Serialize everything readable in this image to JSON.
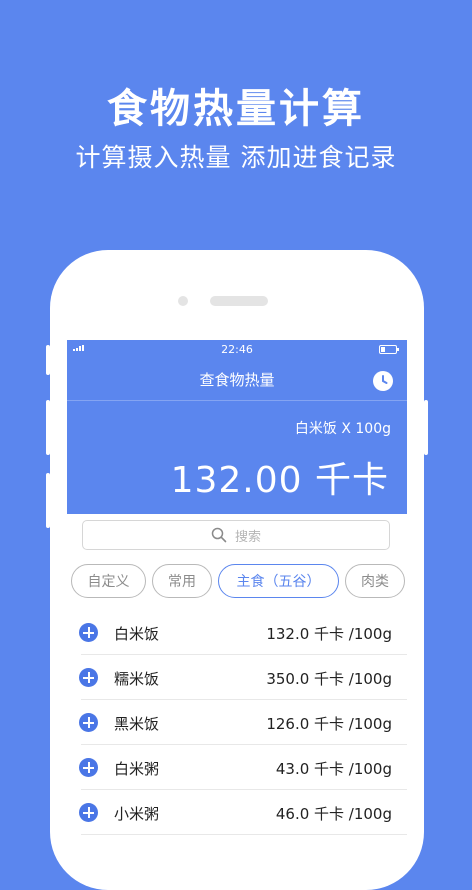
{
  "promo": {
    "title": "食物热量计算",
    "subtitle": "计算摄入热量 添加进食记录"
  },
  "status_bar": {
    "time": "22:46"
  },
  "nav": {
    "title": "查食物热量",
    "history_icon": "clock-icon"
  },
  "result": {
    "food_label": "白米饭 X 100g",
    "calories": "132.00 千卡"
  },
  "search": {
    "placeholder": "搜索"
  },
  "tabs": [
    {
      "label": "自定义"
    },
    {
      "label": "常用"
    },
    {
      "label": "主食（五谷）",
      "active": true
    },
    {
      "label": "肉类"
    }
  ],
  "foods": [
    {
      "name": "白米饭",
      "calories": "132.0 千卡 /100g"
    },
    {
      "name": "糯米饭",
      "calories": "350.0 千卡 /100g"
    },
    {
      "name": "黑米饭",
      "calories": "126.0 千卡 /100g"
    },
    {
      "name": "白米粥",
      "calories": "43.0 千卡 /100g"
    },
    {
      "name": "小米粥",
      "calories": "46.0 千卡 /100g"
    }
  ],
  "colors": {
    "accent": "#5b86ee",
    "add_button": "#4a76e6"
  }
}
